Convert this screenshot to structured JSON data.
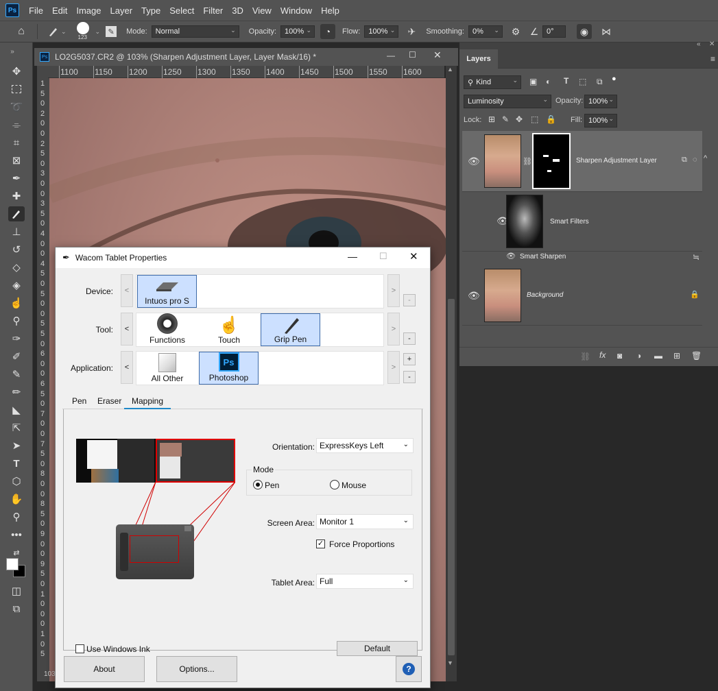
{
  "menubar": {
    "logo": "Ps",
    "items": [
      "File",
      "Edit",
      "Image",
      "Layer",
      "Type",
      "Select",
      "Filter",
      "3D",
      "View",
      "Window",
      "Help"
    ]
  },
  "options_bar": {
    "brush_size": "123",
    "mode_label": "Mode:",
    "mode_value": "Normal",
    "opacity_label": "Opacity:",
    "opacity_value": "100%",
    "flow_label": "Flow:",
    "flow_value": "100%",
    "smoothing_label": "Smoothing:",
    "smoothing_value": "0%",
    "angle_value": "0°"
  },
  "document": {
    "title": "LO2G5037.CR2 @ 103% (Sharpen Adjustment Layer, Layer Mask/16) *",
    "ruler_ticks": [
      "1100",
      "1150",
      "1200",
      "1250",
      "1300",
      "1350",
      "1400",
      "1450",
      "1500",
      "1550",
      "1600"
    ],
    "vruler_digits": [
      "1",
      "5",
      "0",
      "2",
      "0",
      "0",
      "2",
      "5",
      "0",
      "3",
      "0",
      "0",
      "3",
      "5",
      "0",
      "4",
      "0",
      "0",
      "4",
      "5",
      "0",
      "5",
      "0",
      "0",
      "5",
      "5",
      "0",
      "6",
      "0",
      "0",
      "6",
      "5",
      "0",
      "7",
      "0",
      "0",
      "7",
      "5",
      "0",
      "8",
      "0",
      "0",
      "8",
      "5",
      "0",
      "9",
      "0",
      "0",
      "9",
      "5",
      "0",
      "1",
      "0",
      "0",
      "0",
      "1",
      "0",
      "5"
    ],
    "zoom_status": "103"
  },
  "layers_panel": {
    "tab": "Layers",
    "filter_kind": "Kind",
    "blend_mode": "Luminosity",
    "opacity_label": "Opacity:",
    "opacity_value": "100%",
    "lock_label": "Lock:",
    "fill_label": "Fill:",
    "fill_value": "100%",
    "layers": [
      {
        "name": "Sharpen Adjustment Layer"
      },
      {
        "name": "Smart Filters"
      },
      {
        "name": "Smart Sharpen"
      },
      {
        "name": "Background"
      }
    ]
  },
  "wacom": {
    "title": "Wacom Tablet Properties",
    "device_label": "Device:",
    "device_item": "Intuos pro S",
    "tool_label": "Tool:",
    "tool_items": [
      "Functions",
      "Touch",
      "Grip Pen"
    ],
    "app_label": "Application:",
    "app_items": [
      "All Other",
      "Photoshop"
    ],
    "app_ps_icon": "Ps",
    "tabs": [
      "Pen",
      "Eraser",
      "Mapping"
    ],
    "orientation_label": "Orientation:",
    "orientation_value": "ExpressKeys Left",
    "mode_group": "Mode",
    "mode_pen": "Pen",
    "mode_mouse": "Mouse",
    "screen_area_label": "Screen Area:",
    "screen_area_value": "Monitor 1",
    "force_proportions": "Force Proportions",
    "tablet_area_label": "Tablet Area:",
    "tablet_area_value": "Full",
    "use_windows_ink": "Use Windows Ink",
    "default_btn": "Default",
    "about_btn": "About",
    "options_btn": "Options...",
    "help_glyph": "?",
    "arrow_left": "<",
    "arrow_right": ">",
    "minus": "-",
    "plus": "+"
  }
}
